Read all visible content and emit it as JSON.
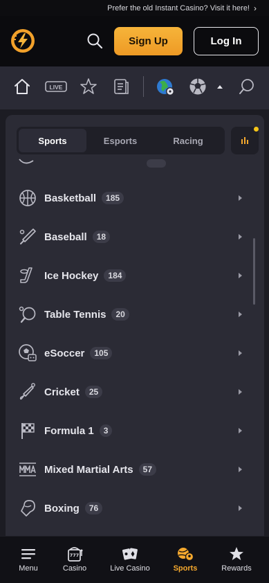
{
  "promo": {
    "text": "Prefer the old Instant Casino? Visit it here!",
    "chevron": "›"
  },
  "header": {
    "logo_icon": "lightning-bolt-logo",
    "signup_label": "Sign Up",
    "login_label": "Log In"
  },
  "nav_icons": [
    "home-icon",
    "live-icon",
    "star-icon",
    "betslip-icon",
    "globe-icon",
    "soccer-ball-icon",
    "caret-up-icon",
    "search-icon"
  ],
  "nav": {
    "live_label": "LIVE"
  },
  "tabs": [
    "Sports",
    "Esports",
    "Racing"
  ],
  "active_tab": "Sports",
  "sports": [
    {
      "name": "Basketball",
      "count": "185",
      "icon": "basketball-icon"
    },
    {
      "name": "Baseball",
      "count": "18",
      "icon": "baseball-bat-icon"
    },
    {
      "name": "Ice Hockey",
      "count": "184",
      "icon": "ice-hockey-icon"
    },
    {
      "name": "Table Tennis",
      "count": "20",
      "icon": "table-tennis-icon"
    },
    {
      "name": "eSoccer",
      "count": "105",
      "icon": "esoccer-icon"
    },
    {
      "name": "Cricket",
      "count": "25",
      "icon": "cricket-bat-icon"
    },
    {
      "name": "Formula 1",
      "count": "3",
      "icon": "checkered-flag-icon"
    },
    {
      "name": "Mixed Martial Arts",
      "count": "57",
      "icon": "mma-icon"
    },
    {
      "name": "Boxing",
      "count": "76",
      "icon": "boxing-glove-icon"
    }
  ],
  "bottom_nav": [
    {
      "label": "Menu",
      "icon": "hamburger-icon"
    },
    {
      "label": "Casino",
      "icon": "slot-machine-icon"
    },
    {
      "label": "Live Casino",
      "icon": "playing-cards-icon"
    },
    {
      "label": "Sports",
      "icon": "sports-icon"
    },
    {
      "label": "Rewards",
      "icon": "star-icon"
    }
  ],
  "colors": {
    "accent": "#f6a92e",
    "background": "#1c1c23",
    "panel": "#2b2b35",
    "notification_dot": "#f5c518"
  }
}
